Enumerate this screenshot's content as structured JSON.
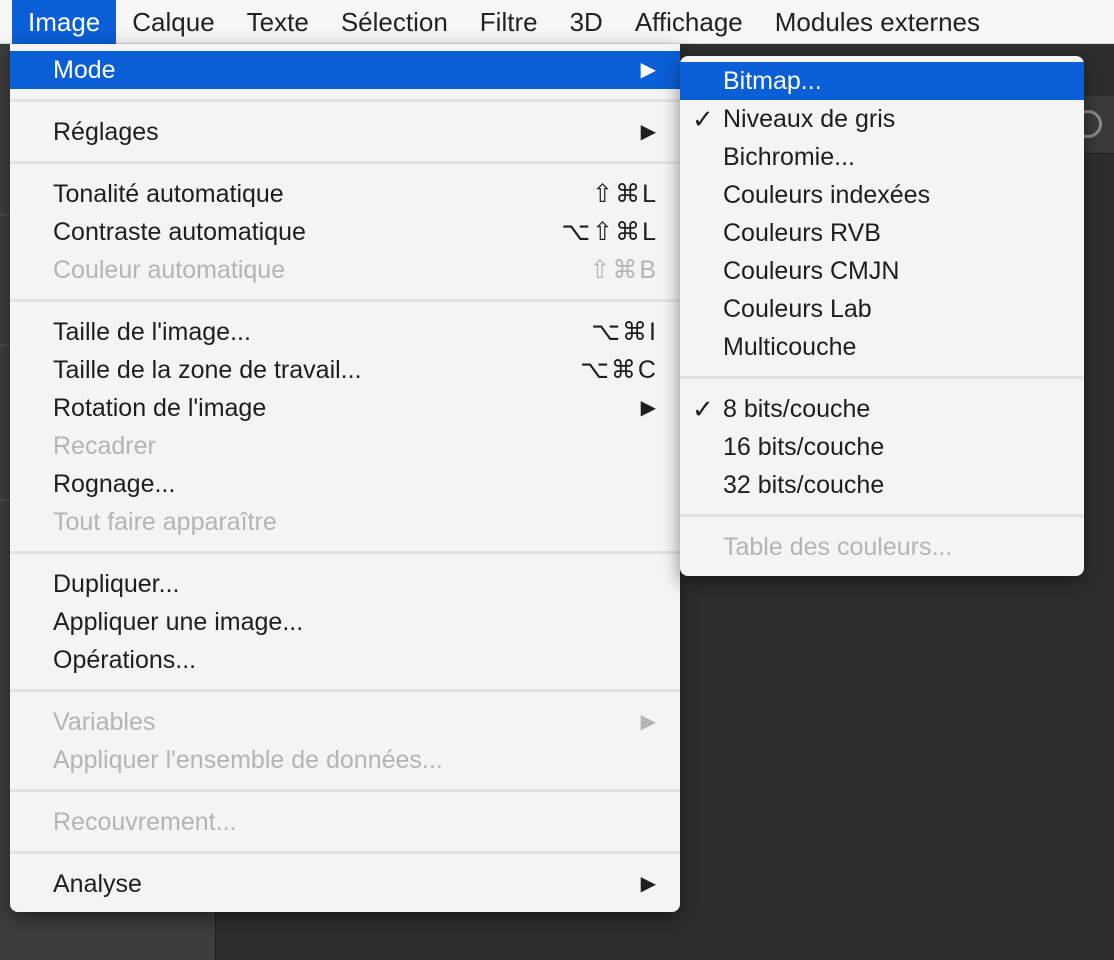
{
  "menubar": {
    "items": [
      "Image",
      "Calque",
      "Texte",
      "Sélection",
      "Filtre",
      "3D",
      "Affichage",
      "Modules externes"
    ],
    "active": "Image"
  },
  "image_menu": {
    "mode": "Mode",
    "reglages": "Réglages",
    "tonalite_auto": "Tonalité automatique",
    "tonalite_auto_shortcut": "⇧⌘L",
    "contraste_auto": "Contraste automatique",
    "contraste_auto_shortcut": "⌥⇧⌘L",
    "couleur_auto": "Couleur automatique",
    "couleur_auto_shortcut": "⇧⌘B",
    "taille_image": "Taille de l'image...",
    "taille_image_shortcut": "⌥⌘I",
    "taille_zone": "Taille de la zone de travail...",
    "taille_zone_shortcut": "⌥⌘C",
    "rotation": "Rotation de l'image",
    "recadrer": "Recadrer",
    "rognage": "Rognage...",
    "tout_faire": "Tout faire apparaître",
    "dupliquer": "Dupliquer...",
    "appliquer_image": "Appliquer une image...",
    "operations": "Opérations...",
    "variables": "Variables",
    "appliquer_ensemble": "Appliquer l'ensemble de données...",
    "recouvrement": "Recouvrement...",
    "analyse": "Analyse",
    "submenu_arrow": "▶"
  },
  "mode_submenu": {
    "bitmap": "Bitmap...",
    "niveaux_gris": "Niveaux de gris",
    "bichromie": "Bichromie...",
    "indexees": "Couleurs indexées",
    "rvb": "Couleurs RVB",
    "cmjn": "Couleurs CMJN",
    "lab": "Couleurs Lab",
    "multicouche": "Multicouche",
    "bits8": "8 bits/couche",
    "bits16": "16 bits/couche",
    "bits32": "32 bits/couche",
    "table_couleurs": "Table des couleurs...",
    "checkmark": "✓"
  },
  "colors": {
    "accent": "#0a5fd6",
    "menu_bg": "#f4f4f4",
    "disabled_text": "#b4b4b4"
  }
}
